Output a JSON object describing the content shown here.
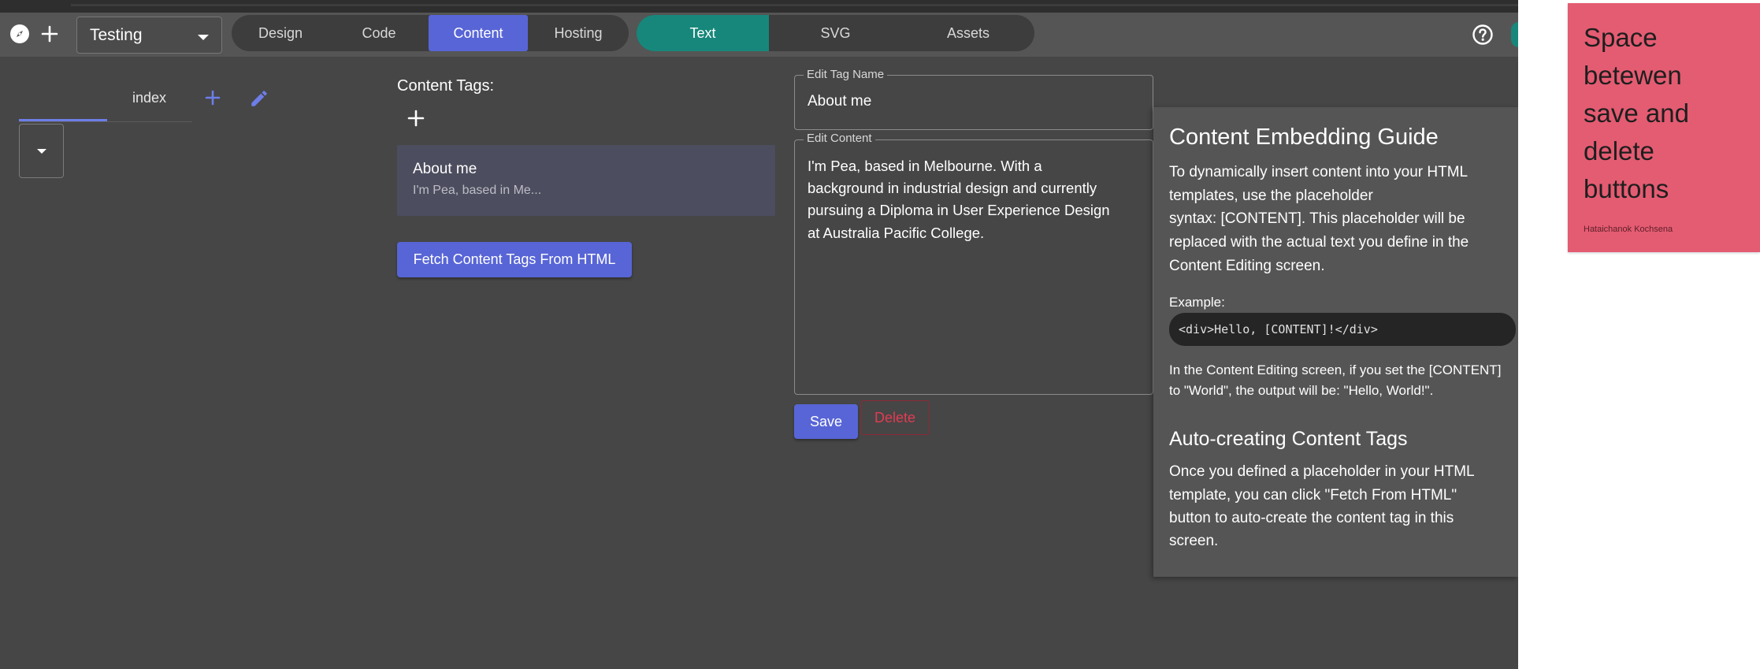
{
  "project": {
    "name": "Testing"
  },
  "main_tabs": [
    "Design",
    "Code",
    "Content",
    "Hosting"
  ],
  "content_tabs": [
    "Text",
    "SVG",
    "Assets"
  ],
  "page_tab": {
    "label": "index"
  },
  "content_tags": {
    "heading": "Content Tags:",
    "items": [
      {
        "title": "About me",
        "preview": "I'm Pea, based in Me..."
      }
    ],
    "fetch_button": "Fetch Content Tags From HTML"
  },
  "editor": {
    "tag_name_label": "Edit Tag Name",
    "tag_name_value": "About me",
    "content_label": "Edit Content",
    "content_lines": [
      "I'm Pea, based in Melbourne. With a",
      "background in industrial design and currently",
      "pursuing a Diploma in User Experience Design",
      "at Australia Pacific College."
    ],
    "save_button": "Save",
    "delete_button": "Delete"
  },
  "guide": {
    "title": "Content Embedding Guide",
    "intro_lines": [
      "To dynamically insert content into your HTML",
      "templates, use the placeholder",
      "syntax: [CONTENT]. This placeholder will be",
      "replaced with the actual text you define in the",
      "Content Editing screen."
    ],
    "example_label": "Example:",
    "example_code": "<div>Hello, [CONTENT]!</div>",
    "example_note_lines": [
      "In the Content Editing screen, if you set the [CONTENT]",
      "to \"World\", the output will be: \"Hello, World!\"."
    ],
    "subtitle": "Auto-creating Content Tags",
    "auto_lines": [
      "Once you defined a placeholder in your HTML",
      "template, you can click \"Fetch From HTML\"",
      "button to auto-create the content tag in this",
      "screen."
    ]
  },
  "sticky_note": {
    "lines": [
      "Space",
      "betewen",
      "save and",
      "delete",
      "buttons"
    ],
    "author": "Hataichanok Kochsena"
  },
  "colors": {
    "accent_blue": "#5865d6",
    "accent_teal": "#17877b",
    "danger": "#e23b52",
    "sticky": "#e45c72"
  }
}
